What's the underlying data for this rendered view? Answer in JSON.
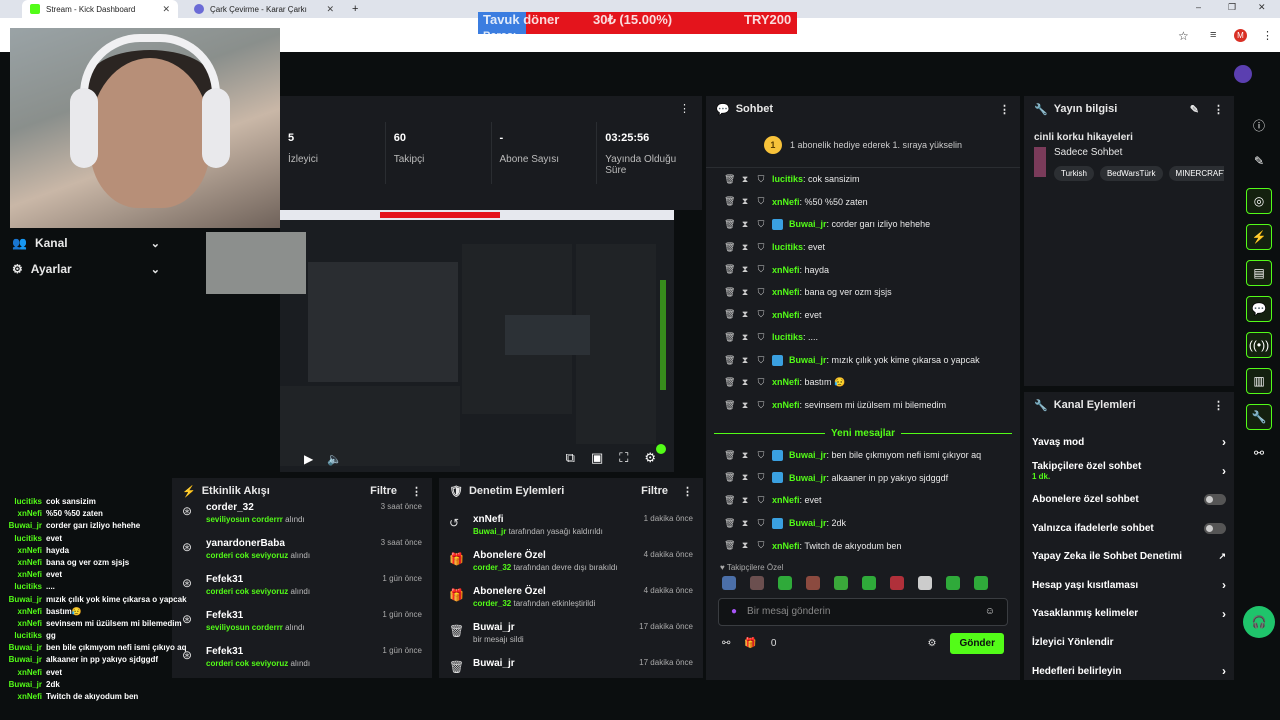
{
  "browser": {
    "tabs": [
      {
        "title": "Stream - Kick Dashboard",
        "active": true
      },
      {
        "title": "Çark Çevirme - Karar Çarkı",
        "active": false
      }
    ],
    "new_tab": "+",
    "window_controls": [
      "–",
      "❐",
      "✕"
    ]
  },
  "overlay": {
    "left": "Tavuk döner",
    "left2": "Parası",
    "middle": "30₺ (15.00%)",
    "right": "TRY200"
  },
  "sidebar": {
    "items": [
      {
        "label": "Kanal",
        "icon": "users-icon"
      },
      {
        "label": "Ayarlar",
        "icon": "gear-icon"
      }
    ]
  },
  "stats": [
    {
      "value": "5",
      "label": "İzleyici"
    },
    {
      "value": "60",
      "label": "Takipçi"
    },
    {
      "value": "-",
      "label": "Abone Sayısı"
    },
    {
      "value": "03:25:56",
      "label": "Yayında Olduğu Süre"
    }
  ],
  "activity": {
    "title": "Etkinlik Akışı",
    "filter": "Filtre",
    "items": [
      {
        "name": "corder_32",
        "detail": "seviliyosun corderrr",
        "action": "alındı",
        "time": "3 saat önce"
      },
      {
        "name": "yanardonerBaba",
        "detail": "corderi cok seviyoruz",
        "action": "alındı",
        "time": "3 saat önce"
      },
      {
        "name": "Fefek31",
        "detail": "corderi cok seviyoruz",
        "action": "alındı",
        "time": "1 gün önce"
      },
      {
        "name": "Fefek31",
        "detail": "seviliyosun corderrr",
        "action": "alındı",
        "time": "1 gün önce"
      },
      {
        "name": "Fefek31",
        "detail": "corderi cok seviyoruz",
        "action": "alındı",
        "time": "1 gün önce"
      }
    ]
  },
  "moderation": {
    "title": "Denetim Eylemleri",
    "filter": "Filtre",
    "items": [
      {
        "name": "xnNefi",
        "actor": "Buwai_jr",
        "detail": "tarafından yasağı kaldırıldı",
        "time": "1 dakika önce",
        "icon": "undo-icon"
      },
      {
        "name": "Abonelere Özel",
        "actor": "corder_32",
        "detail": "tarafından devre dışı bırakıldı",
        "time": "4 dakika önce",
        "icon": "gift-icon"
      },
      {
        "name": "Abonelere Özel",
        "actor": "corder_32",
        "detail": "tarafından etkinleştirildi",
        "time": "4 dakika önce",
        "icon": "gift-icon"
      },
      {
        "name": "Buwai_jr",
        "actor": "",
        "detail": "bir mesajı sildi",
        "time": "17 dakika önce",
        "icon": "trash-icon"
      },
      {
        "name": "Buwai_jr",
        "actor": "",
        "detail": "",
        "time": "17 dakika önce",
        "icon": "trash-icon"
      }
    ]
  },
  "chat": {
    "title": "Sohbet",
    "pinned": "1 abonelik hediye ederek 1. sıraya yükselin",
    "pinned_badge": "1",
    "messages": [
      {
        "user": "lucitiks",
        "text": "cok sansizim",
        "kick": false
      },
      {
        "user": "xnNefi",
        "text": "%50 %50 zaten",
        "kick": false
      },
      {
        "user": "Buwai_jr",
        "text": "corder garı izliyo hehehe",
        "kick": true
      },
      {
        "user": "lucitiks",
        "text": "evet",
        "kick": false
      },
      {
        "user": "xnNefi",
        "text": "hayda",
        "kick": false
      },
      {
        "user": "xnNefi",
        "text": "bana og ver ozm sjsjs",
        "kick": false
      },
      {
        "user": "xnNefi",
        "text": "evet",
        "kick": false
      },
      {
        "user": "lucitiks",
        "text": "....",
        "kick": false
      },
      {
        "user": "Buwai_jr",
        "text": "mızık çılık yok kime çıkarsa o yapcak",
        "kick": true
      },
      {
        "user": "xnNefi",
        "text": "bastım 😥",
        "kick": false
      },
      {
        "user": "xnNefi",
        "text": "sevinsem mi üzülsem mi bilemedim",
        "kick": false
      },
      {
        "user": "lucitiks",
        "text": "gg",
        "kick": false
      }
    ],
    "new_messages": "Yeni mesajlar",
    "new": [
      {
        "user": "Buwai_jr",
        "text": "ben bile çıkmıyom nefi ismi çıkıyor aq",
        "kick": true
      },
      {
        "user": "Buwai_jr",
        "text": "alkaaner in pp yakıyo sjdggdf",
        "kick": true
      },
      {
        "user": "xnNefi",
        "text": "evet",
        "kick": false
      },
      {
        "user": "Buwai_jr",
        "text": "2dk",
        "kick": true
      },
      {
        "user": "xnNefi",
        "text": "Twitch de akıyodum ben",
        "kick": false
      }
    ],
    "emote_label": "Takipçilere Özel",
    "input_placeholder": "Bir mesaj gönderin",
    "gift_count": "0",
    "send": "Gönder"
  },
  "streaminfo": {
    "title": "Yayın bilgisi",
    "stream_title": "cinli korku hikayeleri",
    "category": "Sadece Sohbet",
    "tags": [
      "Turkish",
      "BedWarsTürk",
      "MINERCRAFT"
    ]
  },
  "channel_actions": {
    "title": "Kanal Eylemleri",
    "items": [
      {
        "label": "Yavaş mod",
        "control": "chevron"
      },
      {
        "label": "Takipçilere özel sohbet",
        "sub": "1 dk.",
        "control": "chevron"
      },
      {
        "label": "Abonelere özel sohbet",
        "control": "toggle"
      },
      {
        "label": "Yalnızca ifadelerle sohbet",
        "control": "toggle"
      },
      {
        "label": "Yapay Zeka ile Sohbet Denetimi",
        "control": "external"
      },
      {
        "label": "Hesap yaşı kısıtlaması",
        "control": "chevron"
      },
      {
        "label": "Yasaklanmış kelimeler",
        "control": "chevron"
      },
      {
        "label": "İzleyici Yönlendir",
        "control": "none"
      },
      {
        "label": "Hedefleri belirleyin",
        "control": "chevron"
      }
    ]
  },
  "overlay_chat": [
    {
      "user": "lucitiks",
      "text": "cok sansizim"
    },
    {
      "user": "xnNefi",
      "text": "%50 %50 zaten"
    },
    {
      "user": "Buwai_jr",
      "text": "corder garı izliyo hehehe"
    },
    {
      "user": "lucitiks",
      "text": "evet"
    },
    {
      "user": "xnNefi",
      "text": "hayda"
    },
    {
      "user": "xnNefi",
      "text": "bana og ver ozm sjsjs"
    },
    {
      "user": "xnNefi",
      "text": "evet"
    },
    {
      "user": "lucitiks",
      "text": "...."
    },
    {
      "user": "Buwai_jr",
      "text": "mızık çılık yok kime çıkarsa o yapcak"
    },
    {
      "user": "xnNefi",
      "text": "bastım😥"
    },
    {
      "user": "xnNefi",
      "text": "sevinsem mi üzülsem mi bilemedim"
    },
    {
      "user": "lucitiks",
      "text": "gg"
    },
    {
      "user": "Buwai_jr",
      "text": "ben bile çıkmıyom nefi ismi çıkıyo aq"
    },
    {
      "user": "Buwai_jr",
      "text": "alkaaner in pp yakıyo sjdggdf"
    },
    {
      "user": "xnNefi",
      "text": "evet"
    },
    {
      "user": "Buwai_jr",
      "text": "2dk"
    },
    {
      "user": "xnNefi",
      "text": "Twitch de akıyodum ben"
    }
  ]
}
